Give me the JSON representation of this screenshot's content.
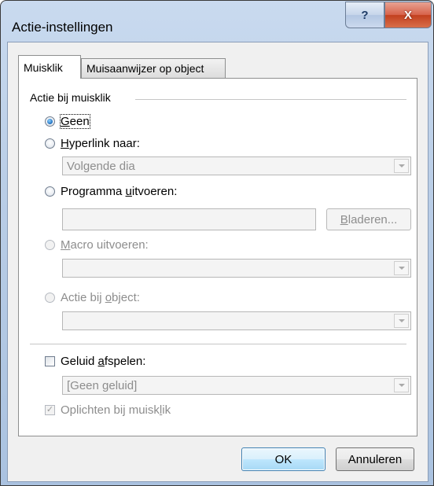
{
  "window": {
    "title": "Actie-instellingen",
    "help_glyph": "?",
    "close_glyph": "X"
  },
  "tabs": [
    {
      "label": "Muisklik",
      "selected": true
    },
    {
      "label": "Muisaanwijzer op object",
      "selected": false
    }
  ],
  "group": {
    "label": "Actie bij muisklik"
  },
  "options": {
    "none": {
      "label_u": "G",
      "label_rest": "een",
      "checked": true
    },
    "hyperlink": {
      "label_u": "H",
      "label_rest": "yperlink naar:",
      "checked": false
    },
    "hyperlink_value": "Volgende dia",
    "program": {
      "label_pre": "Programma ",
      "label_u": "u",
      "label_rest": "itvoeren:",
      "checked": false
    },
    "program_value": "",
    "browse_u": "B",
    "browse_rest": "laderen...",
    "macro": {
      "label_u": "M",
      "label_rest": "acro uitvoeren:",
      "checked": false,
      "enabled": false
    },
    "macro_value": "",
    "object_action": {
      "label_pre": "Actie bij ",
      "label_u": "o",
      "label_rest": "bject:",
      "checked": false,
      "enabled": false
    },
    "object_action_value": ""
  },
  "sound": {
    "label_pre": "Geluid ",
    "label_u": "a",
    "label_rest": "fspelen:",
    "checked": false,
    "value": "[Geen geluid]"
  },
  "highlight": {
    "label_pre": "Oplichten bij muisk",
    "label_u": "l",
    "label_rest": "ik",
    "checked": true,
    "enabled": false
  },
  "buttons": {
    "ok": "OK",
    "cancel": "Annuleren"
  },
  "colors": {
    "title_gradient_top": "#c9daef",
    "close_button": "#c2401f",
    "ok_border": "#3c7fb1",
    "radio_dot": "#1f6fbf"
  }
}
